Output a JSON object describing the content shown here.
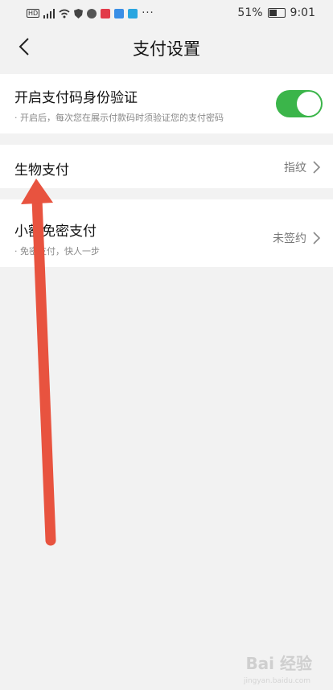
{
  "status_bar": {
    "battery_percent_text": "51%",
    "battery_level": 0.51,
    "time": "9:01",
    "icons": [
      "hd-icon",
      "signal-icon",
      "wifi-icon",
      "shield-icon",
      "chat-icon",
      "app-red-icon",
      "cloud-icon",
      "search-app-icon",
      "more-dots-icon"
    ]
  },
  "nav": {
    "title": "支付设置",
    "back_icon": "chevron-left-icon"
  },
  "settings": {
    "pay_code_verify": {
      "title": "开启支付码身份验证",
      "description": "· 开启后，每次您在展示付款码时须验证您的支付密码",
      "enabled": true
    },
    "biometric_pay": {
      "title": "生物支付",
      "value": "指纹"
    },
    "small_amount_pay": {
      "title": "小额免密支付",
      "description": "· 免密支付，快人一步",
      "value": "未签约"
    }
  },
  "colors": {
    "toggle_on": "#3bb54a",
    "annotation_arrow": "#e8533f",
    "background": "#f2f2f2"
  },
  "watermark": {
    "text": "Bai 经验",
    "sub": "jingyan.baidu.com"
  }
}
